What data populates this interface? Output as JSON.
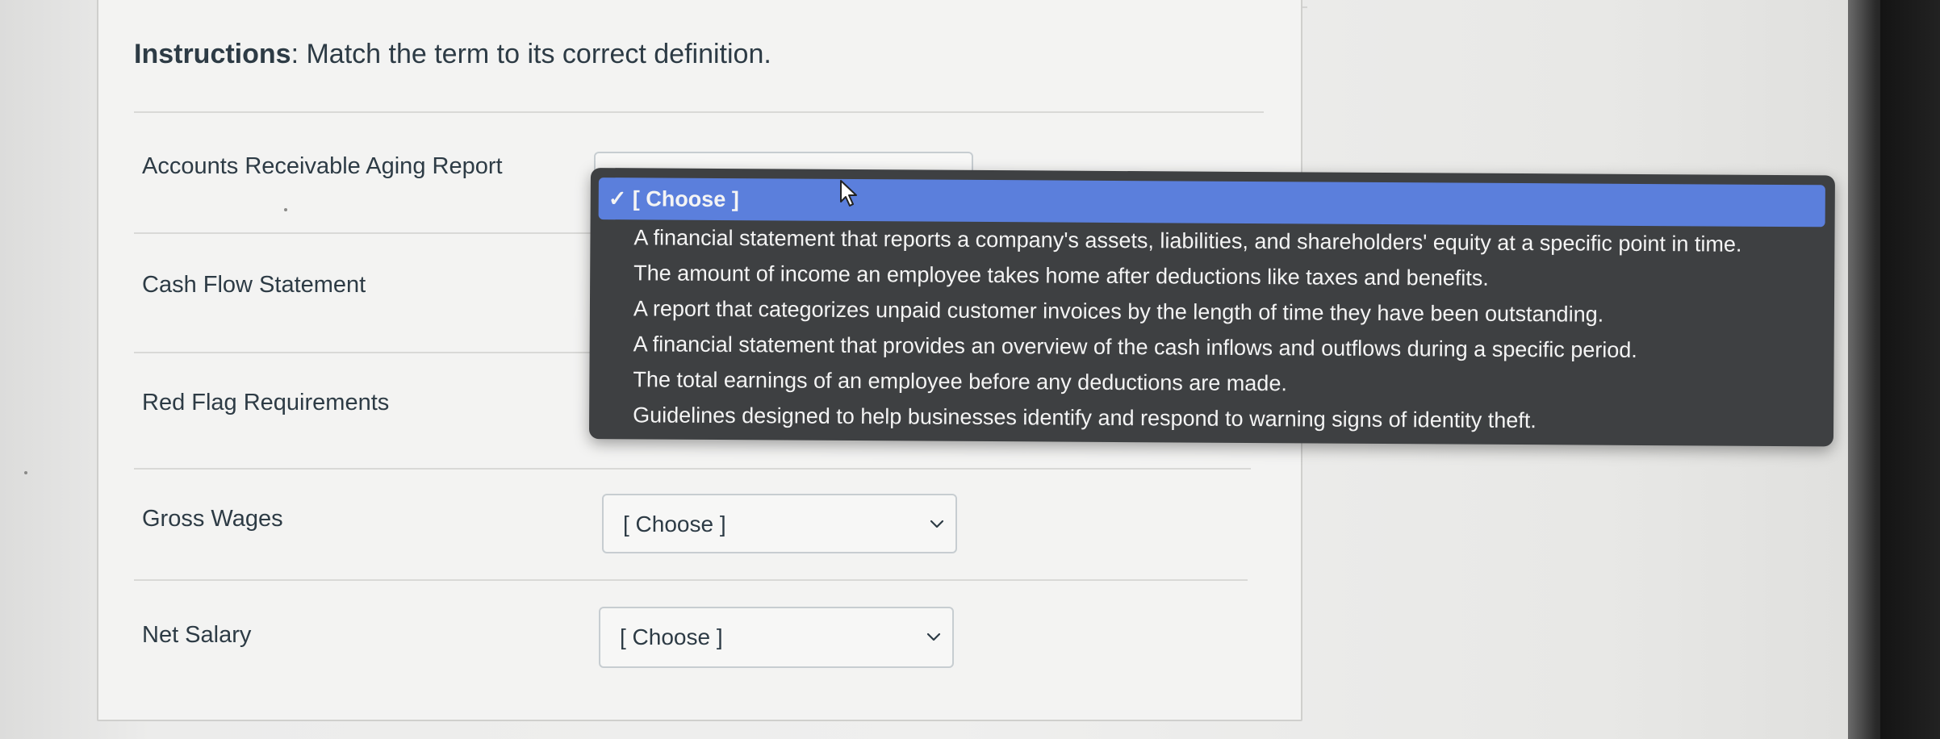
{
  "instructions": {
    "label": "Instructions",
    "text": ": Match the term to its correct definition."
  },
  "terms": [
    {
      "label": "Accounts Receivable Aging Report",
      "selected": "[ Choose ]"
    },
    {
      "label": "Cash Flow Statement",
      "selected": "[ Choose ]"
    },
    {
      "label": "Red Flag Requirements",
      "selected": "[ Choose ]"
    },
    {
      "label": "Gross Wages",
      "selected": "[ Choose ]"
    },
    {
      "label": "Net Salary",
      "selected": "[ Choose ]"
    }
  ],
  "dropdown": {
    "checkmark": "✓",
    "selected_option": "[ Choose ]",
    "options": [
      "A financial statement that reports a company's assets, liabilities, and shareholders' equity at a specific point in time.",
      "The amount of income an employee takes home after deductions like taxes and benefits.",
      "A report that categorizes unpaid customer invoices by the length of time they have been outstanding.",
      "A financial statement that provides an overview of the cash inflows and outflows during a specific period.",
      "The total earnings of an employee before any deductions are made.",
      "Guidelines designed to help businesses identify and respond to warning signs of identity theft."
    ]
  },
  "colors": {
    "dropdown_bg": "#3e4042",
    "highlight": "#5b7fdc",
    "text": "#2d3b45"
  }
}
